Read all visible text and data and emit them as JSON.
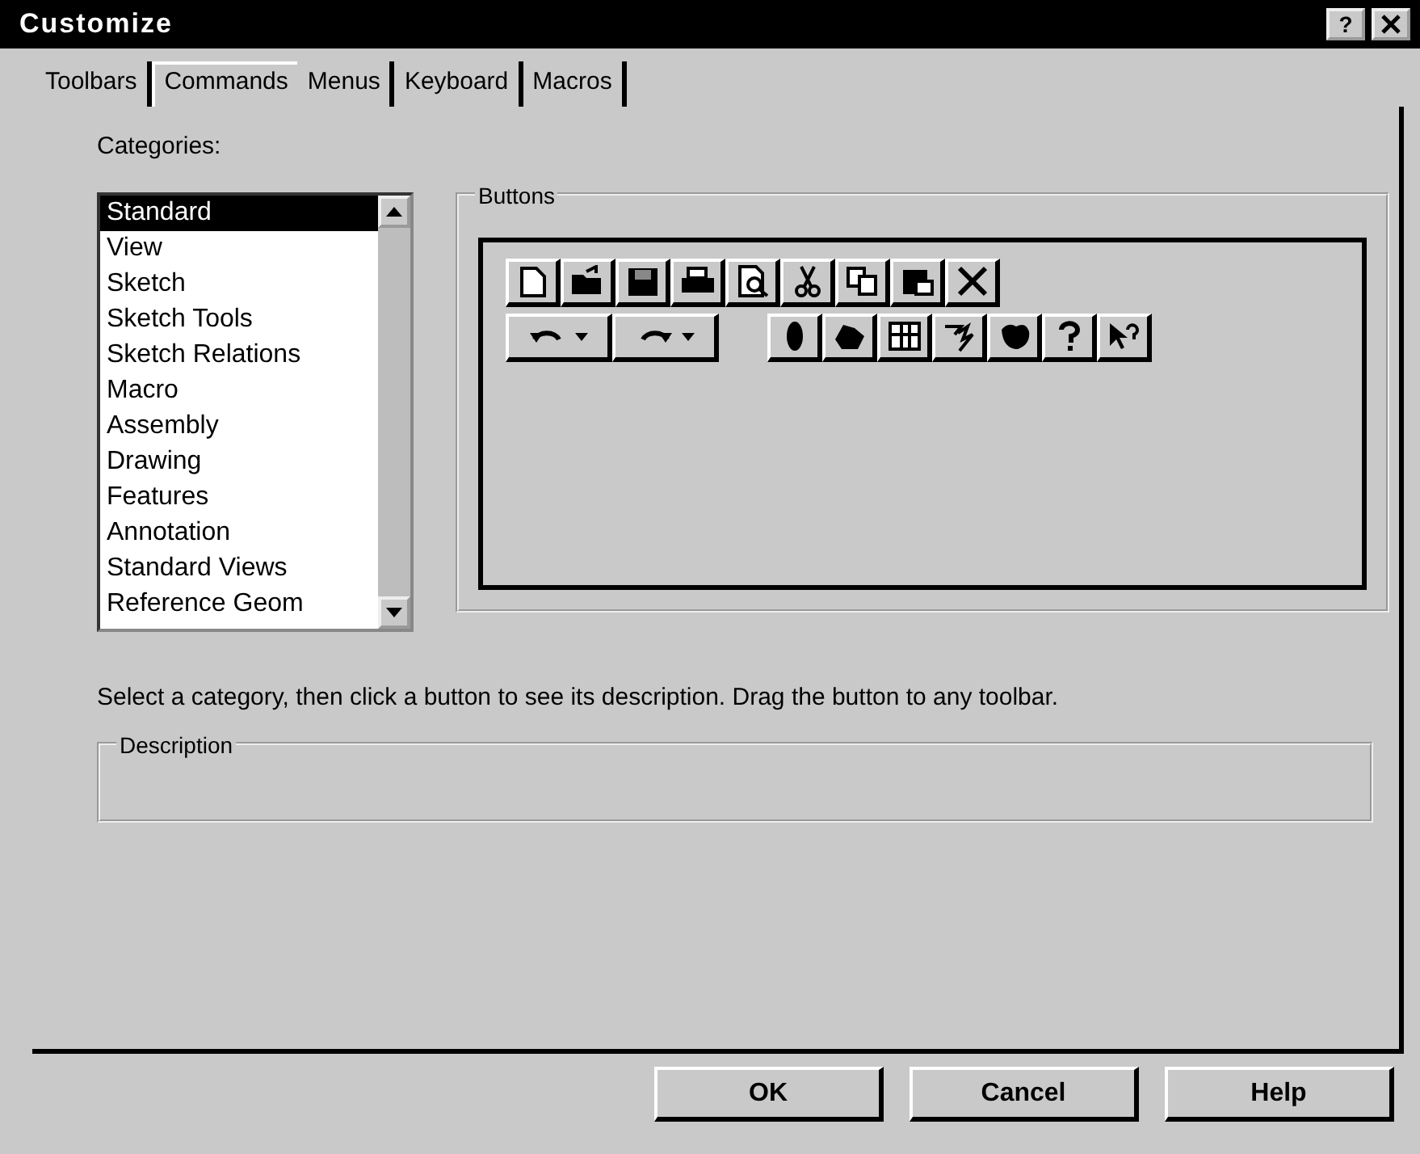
{
  "window": {
    "title": "Customize",
    "help_button": "?"
  },
  "tabs": [
    {
      "label": "Toolbars",
      "selected": false
    },
    {
      "label": "Commands",
      "selected": true
    },
    {
      "label": "Menus",
      "selected": false
    },
    {
      "label": "Keyboard",
      "selected": false
    },
    {
      "label": "Macros",
      "selected": false
    }
  ],
  "categories": {
    "label": "Categories:",
    "items": [
      {
        "label": "Standard",
        "selected": true
      },
      {
        "label": "View",
        "selected": false
      },
      {
        "label": "Sketch",
        "selected": false
      },
      {
        "label": "Sketch Tools",
        "selected": false
      },
      {
        "label": "Sketch Relations",
        "selected": false
      },
      {
        "label": "Macro",
        "selected": false
      },
      {
        "label": "Assembly",
        "selected": false
      },
      {
        "label": "Drawing",
        "selected": false
      },
      {
        "label": "Features",
        "selected": false
      },
      {
        "label": "Annotation",
        "selected": false
      },
      {
        "label": "Standard Views",
        "selected": false
      },
      {
        "label": "Reference Geom",
        "selected": false
      }
    ]
  },
  "buttons_group": {
    "title": "Buttons"
  },
  "hint": "Select a category, then click a button to see its description. Drag the button to any toolbar.",
  "description": {
    "title": "Description"
  },
  "dialog_buttons": [
    "OK",
    "Cancel",
    "Help"
  ]
}
